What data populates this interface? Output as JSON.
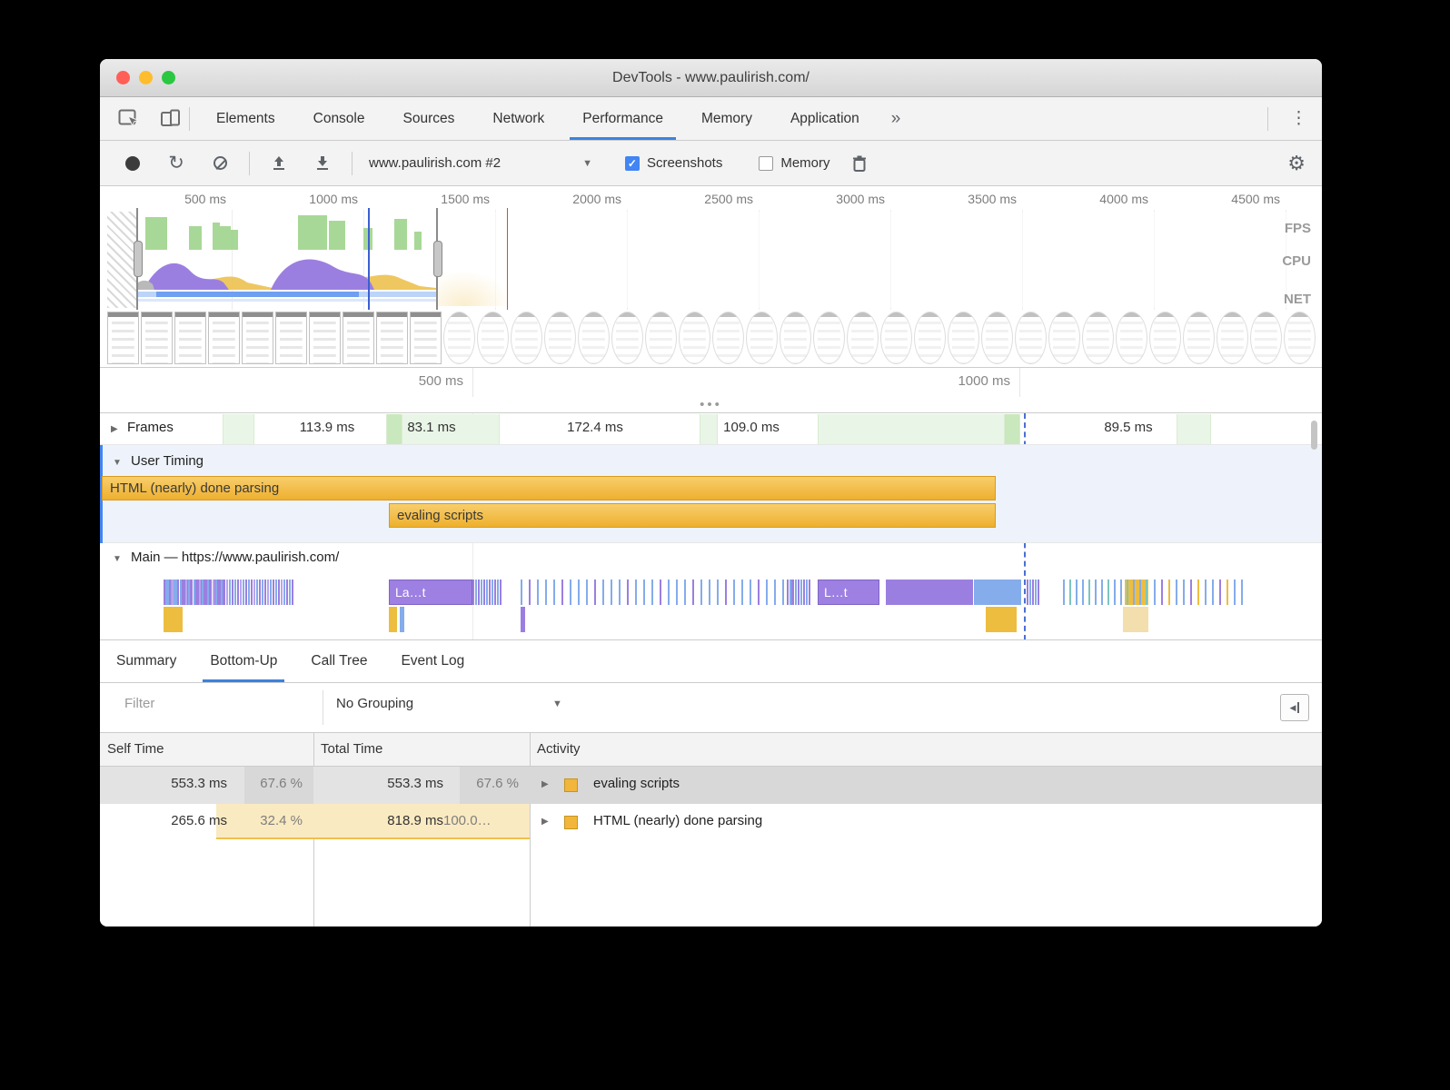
{
  "window": {
    "title": "DevTools - www.paulirish.com/"
  },
  "tabbar": {
    "tabs": [
      "Elements",
      "Console",
      "Sources",
      "Network",
      "Performance",
      "Memory",
      "Application"
    ],
    "active_index": 4
  },
  "toolbar": {
    "profile_name": "www.paulirish.com #2",
    "screenshots_label": "Screenshots",
    "memory_label": "Memory"
  },
  "overview": {
    "ticks": [
      "500 ms",
      "1000 ms",
      "1500 ms",
      "2000 ms",
      "2500 ms",
      "3000 ms",
      "3500 ms",
      "4000 ms",
      "4500 ms"
    ],
    "lane_labels": [
      "FPS",
      "CPU",
      "NET"
    ]
  },
  "detail_ruler": {
    "ticks": [
      "500 ms",
      "1000 ms"
    ]
  },
  "tracks": {
    "frames": {
      "label": "Frames",
      "frame_times": [
        "113.9 ms",
        "83.1 ms",
        "172.4 ms",
        "109.0 ms",
        "89.5 ms"
      ]
    },
    "user_timing": {
      "label": "User Timing",
      "bars": [
        {
          "label": "HTML (nearly) done parsing"
        },
        {
          "label": "evaling scripts"
        }
      ]
    },
    "main": {
      "label": "Main — https://www.paulirish.com/",
      "flame_labels": [
        "La…t",
        "L…t"
      ]
    }
  },
  "bottom_panel": {
    "tabs": [
      "Summary",
      "Bottom-Up",
      "Call Tree",
      "Event Log"
    ],
    "active_tab_index": 1,
    "filter_placeholder": "Filter",
    "grouping": "No Grouping",
    "table": {
      "headers": [
        "Self Time",
        "Total Time",
        "Activity"
      ],
      "rows": [
        {
          "self": "553.3 ms",
          "self_pct": "67.6 %",
          "total": "553.3 ms",
          "total_pct": "67.6 %",
          "activity": "evaling scripts"
        },
        {
          "self": "265.6 ms",
          "self_pct": "32.4 %",
          "total": "818.9 ms",
          "total_pct": "100.0…",
          "activity": "HTML (nearly) done parsing"
        }
      ]
    }
  }
}
